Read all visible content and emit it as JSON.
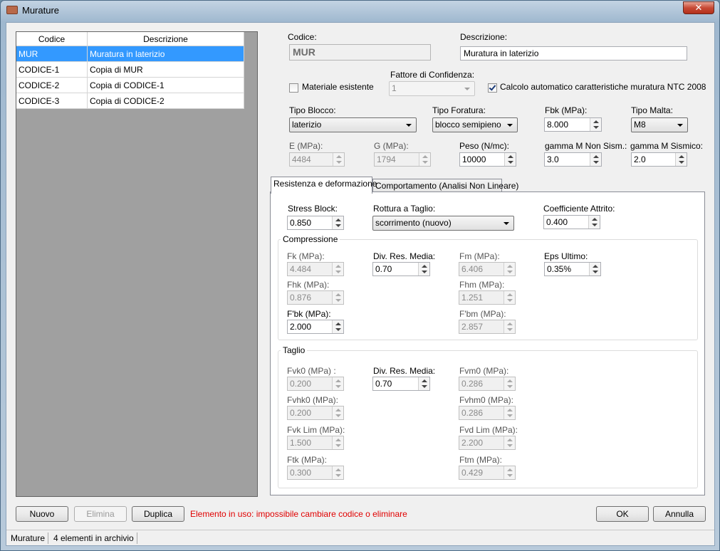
{
  "window": {
    "title": "Murature",
    "close_glyph": "✕"
  },
  "grid": {
    "headers": {
      "codice": "Codice",
      "descrizione": "Descrizione"
    },
    "rows": [
      {
        "codice": "MUR",
        "descrizione": "Muratura in laterizio"
      },
      {
        "codice": "CODICE-1",
        "descrizione": "Copia di MUR"
      },
      {
        "codice": "CODICE-2",
        "descrizione": "Copia di CODICE-1"
      },
      {
        "codice": "CODICE-3",
        "descrizione": "Copia di CODICE-2"
      }
    ]
  },
  "form": {
    "codice_label": "Codice:",
    "codice_value": "MUR",
    "descrizione_label": "Descrizione:",
    "descrizione_value": "Muratura in laterizio",
    "materiale_esistente_label": "Materiale esistente",
    "materiale_esistente_checked": false,
    "fattore_label": "Fattore di Confidenza:",
    "fattore_value": "1",
    "calcolo_label": "Calcolo automatico caratteristiche muratura NTC 2008",
    "calcolo_checked": true,
    "tipo_blocco_label": "Tipo Blocco:",
    "tipo_blocco_value": "laterizio",
    "tipo_foratura_label": "Tipo Foratura:",
    "tipo_foratura_value": "blocco semipieno",
    "fbk_label": "Fbk (MPa):",
    "fbk_value": "8.000",
    "tipo_malta_label": "Tipo Malta:",
    "tipo_malta_value": "M8",
    "e_label": "E (MPa):",
    "e_value": "4484",
    "g_label": "G (MPa):",
    "g_value": "1794",
    "peso_label": "Peso (N/mc):",
    "peso_value": "10000",
    "gamma_ns_label": "gamma M Non Sism.:",
    "gamma_ns_value": "3.0",
    "gamma_s_label": "gamma M Sismico:",
    "gamma_s_value": "2.0"
  },
  "tabs": [
    {
      "label": "Resistenza e deformazione",
      "active": true
    },
    {
      "label": "Comportamento (Analisi Non Lineare)",
      "active": false
    }
  ],
  "resistenza": {
    "stress_block_label": "Stress Block:",
    "stress_block_value": "0.850",
    "rottura_label": "Rottura a Taglio:",
    "rottura_value": "scorrimento (nuovo)",
    "attrito_label": "Coefficiente Attrito:",
    "attrito_value": "0.400",
    "compressione": {
      "title": "Compressione",
      "fk_label": "Fk (MPa):",
      "fk_value": "4.484",
      "div1_label": "Div. Res. Media:",
      "div1_value": "0.70",
      "fm_label": "Fm (MPa):",
      "fm_value": "6.406",
      "eps_label": "Eps Ultimo:",
      "eps_value": "0.35%",
      "fhk_label": "Fhk (MPa):",
      "fhk_value": "0.876",
      "fhm_label": "Fhm (MPa):",
      "fhm_value": "1.251",
      "fbk2_label": "F'bk (MPa):",
      "fbk2_value": "2.000",
      "fbm_label": "F'bm (MPa):",
      "fbm_value": "2.857"
    },
    "taglio": {
      "title": "Taglio",
      "fvk0_label": "Fvk0 (MPa) :",
      "fvk0_value": "0.200",
      "div2_label": "Div. Res. Media:",
      "div2_value": "0.70",
      "fvm0_label": "Fvm0 (MPa):",
      "fvm0_value": "0.286",
      "fvhk0_label": "Fvhk0 (MPa):",
      "fvhk0_value": "0.200",
      "fvhm0_label": "Fvhm0 (MPa):",
      "fvhm0_value": "0.286",
      "fvklim_label": "Fvk Lim (MPa):",
      "fvklim_value": "1.500",
      "fvdlim_label": "Fvd Lim (MPa):",
      "fvdlim_value": "2.200",
      "ftk_label": "Ftk (MPa):",
      "ftk_value": "0.300",
      "ftm_label": "Ftm (MPa):",
      "ftm_value": "0.429"
    }
  },
  "buttons": {
    "nuovo": "Nuovo",
    "elimina": "Elimina",
    "duplica": "Duplica",
    "ok": "OK",
    "annulla": "Annulla"
  },
  "error_message": "Elemento in uso: impossibile cambiare codice o eliminare",
  "statusbar": {
    "section": "Murature",
    "count": "4 elementi in archivio"
  },
  "colors": {
    "selection": "#3399ff",
    "error": "#e00000"
  }
}
